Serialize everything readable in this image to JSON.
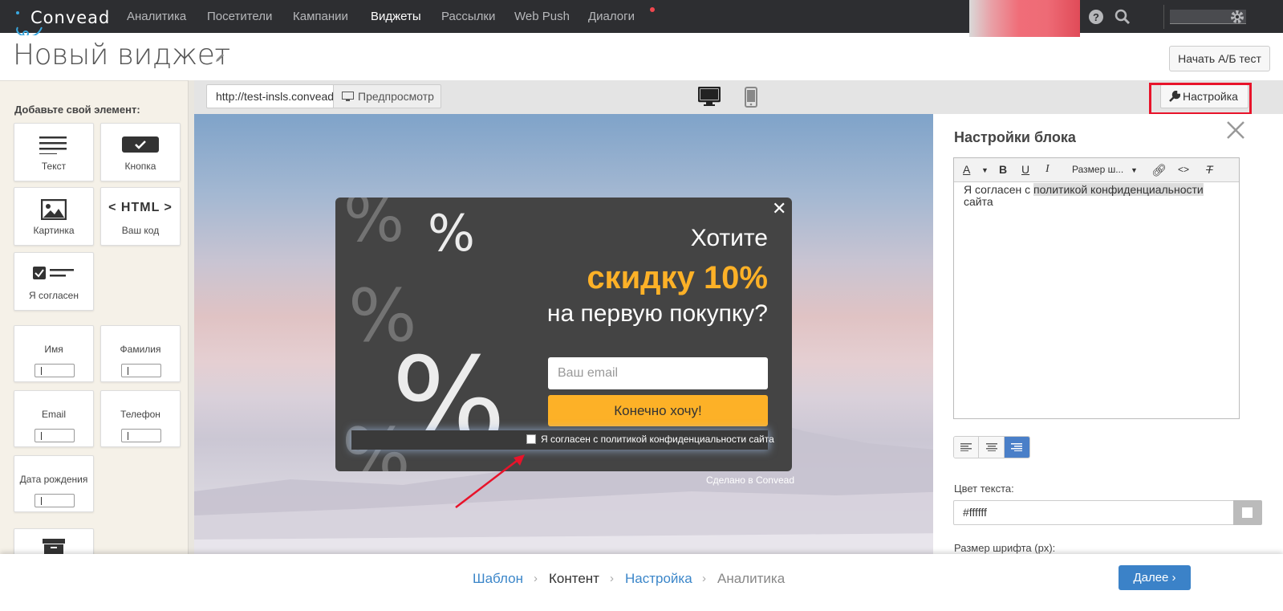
{
  "nav": {
    "logo": "Convead",
    "items": [
      "Аналитика",
      "Посетители",
      "Кампании",
      "Виджеты",
      "Рассылки",
      "Web Push",
      "Диалоги"
    ],
    "active": "Виджеты",
    "icons": [
      "help-icon",
      "search-icon",
      "gear-icon"
    ]
  },
  "header": {
    "title": "Новый виджет",
    "ab_test_label": "Начать А/Б тест"
  },
  "sidebar": {
    "heading": "Добавьте свой элемент:",
    "tiles": [
      "Текст",
      "Кнопка",
      "Картинка",
      "Ваш код",
      "Я согласен",
      "Имя",
      "Фамилия",
      "Email",
      "Телефон",
      "Дата рождения"
    ],
    "html_glyph": "< HTML >"
  },
  "toolbar": {
    "url": "http://test-insls.convead.ru",
    "preview_label": "Предпросмотр",
    "settings_label": "Настройка"
  },
  "popup": {
    "line1": "Хотите",
    "line2": "скидку 10%",
    "line3": "на первую покупку?",
    "email_placeholder": "Ваш email",
    "button": "Конечно хочу!",
    "agree": "Я согласен с политикой конфиденциальности сайта",
    "made_by": "Сделано в Convead",
    "close": "✕"
  },
  "panel": {
    "title": "Настройки блока",
    "font_size_dropdown": "Размер ш...",
    "editor_text_plain": "Я согласен с ",
    "editor_text_link": "политикой конфиденциальности",
    "editor_text_tail": "сайта",
    "text_color_label": "Цвет текста:",
    "text_color_value": "#ffffff",
    "font_size_label": "Размер шрифта (px):"
  },
  "steps": {
    "items": [
      "Шаблон",
      "Контент",
      "Настройка",
      "Аналитика"
    ],
    "current": "Контент",
    "next_label": "Далее"
  }
}
